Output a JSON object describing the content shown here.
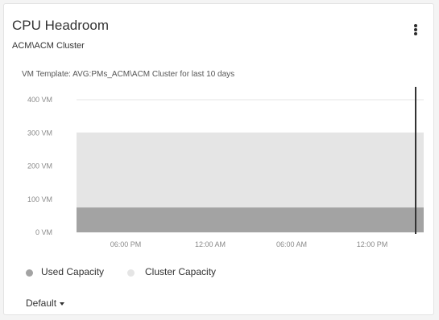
{
  "widget": {
    "title": "CPU Headroom",
    "subtitle": "ACM\\ACM Cluster",
    "menu_icon": "kebab-vertical-icon",
    "template_line": "VM Template: AVG:PMs_ACM\\ACM Cluster for last 10 days"
  },
  "chart_data": {
    "type": "area",
    "title": "",
    "xlabel": "",
    "ylabel": "",
    "y_ticks": [
      "0 VM",
      "100 VM",
      "200 VM",
      "300 VM",
      "400 VM"
    ],
    "y_tick_values": [
      0,
      100,
      200,
      300,
      400
    ],
    "ylim": [
      0,
      400
    ],
    "x_ticks": [
      "06:00 PM",
      "12:00 AM",
      "06:00 AM",
      "12:00 PM"
    ],
    "grid": true,
    "legend_position": "bottom-left",
    "series": [
      {
        "name": "Used Capacity",
        "value": 75,
        "color": "#a3a3a3"
      },
      {
        "name": "Cluster Capacity",
        "value": 300,
        "color": "#e5e5e5"
      }
    ],
    "marker_line": true
  },
  "legend": [
    {
      "label": "Used Capacity",
      "color": "#a3a3a3"
    },
    {
      "label": "Cluster Capacity",
      "color": "#e5e5e5"
    }
  ],
  "dropdown": {
    "label": "Default"
  }
}
